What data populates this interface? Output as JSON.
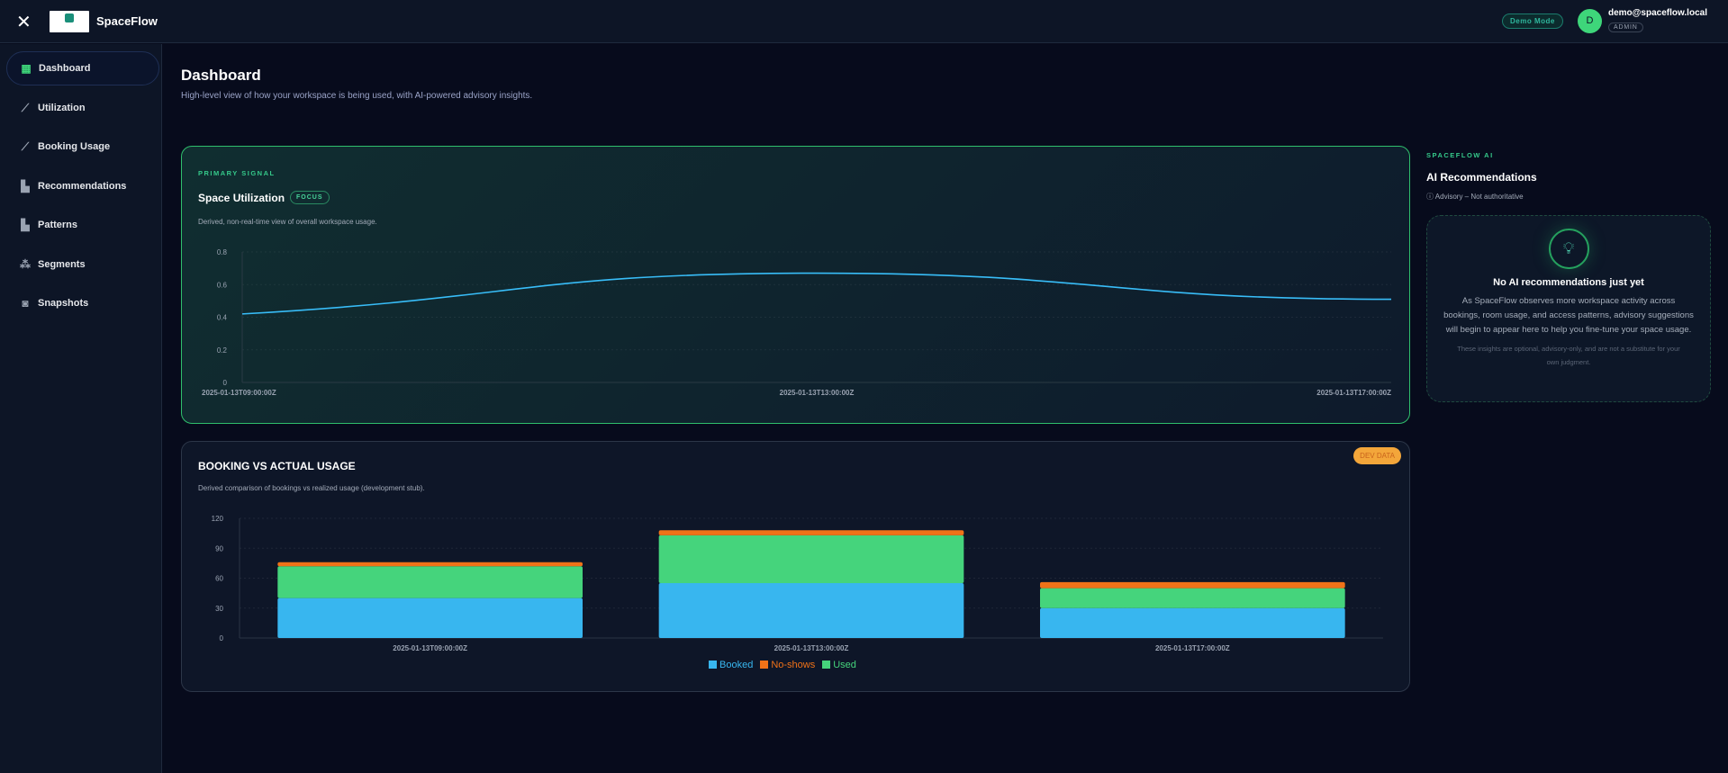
{
  "header": {
    "brand": "SpaceFlow",
    "demo_badge": "Demo Mode",
    "avatar_initial": "D",
    "email": "demo@spaceflow.local",
    "role": "ADMIN"
  },
  "sidebar": {
    "items": [
      {
        "label": "Dashboard",
        "icon": "dashboard-icon"
      },
      {
        "label": "Utilization",
        "icon": "sparkline-icon"
      },
      {
        "label": "Booking Usage",
        "icon": "trend-icon"
      },
      {
        "label": "Recommendations",
        "icon": "grid-icon"
      },
      {
        "label": "Patterns",
        "icon": "grid-icon"
      },
      {
        "label": "Segments",
        "icon": "group-icon"
      },
      {
        "label": "Snapshots",
        "icon": "camera-icon"
      }
    ]
  },
  "page": {
    "title": "Dashboard",
    "subtitle": "High-level view of how your workspace is being used, with AI-powered advisory insights."
  },
  "utilization": {
    "kicker": "PRIMARY SIGNAL",
    "title": "Space Utilization",
    "badge": "FOCUS",
    "description": "Derived, non-real-time view of overall workspace usage."
  },
  "booking": {
    "title": "BOOKING VS ACTUAL USAGE",
    "badge": "DEV DATA",
    "description": "Derived comparison of bookings vs realized usage (development stub)."
  },
  "ai": {
    "kicker": "SPACEFLOW AI",
    "title": "AI Recommendations",
    "note": "Advisory – Not authoritative",
    "empty_title": "No AI recommendations just yet",
    "empty_body": "As SpaceFlow observes more workspace activity across bookings, room usage, and access patterns, advisory suggestions will begin to appear here to help you fine-tune your space usage.",
    "empty_footnote": "These insights are optional, advisory-only, and are not a substitute for your own judgment."
  },
  "chart_data": [
    {
      "type": "line",
      "title": "Space Utilization",
      "x": [
        "2025-01-13T09:00:00Z",
        "2025-01-13T13:00:00Z",
        "2025-01-13T17:00:00Z"
      ],
      "values": [
        0.42,
        0.67,
        0.51
      ],
      "yticks": [
        "0",
        "0.2",
        "0.4",
        "0.6",
        "0.8"
      ],
      "ylim": [
        0,
        0.8
      ],
      "color": "#38bdf8"
    },
    {
      "type": "bar",
      "stacked": true,
      "title": "BOOKING VS ACTUAL USAGE",
      "categories": [
        "2025-01-13T09:00:00Z",
        "2025-01-13T13:00:00Z",
        "2025-01-13T17:00:00Z"
      ],
      "yticks": [
        "0",
        "30",
        "60",
        "90",
        "120"
      ],
      "ylim": [
        0,
        120
      ],
      "legend": "bottom",
      "series": [
        {
          "name": "Booked",
          "values": [
            40,
            55,
            30
          ],
          "color": "#38b6ef"
        },
        {
          "name": "Used",
          "values": [
            32,
            48,
            20
          ],
          "color": "#45d47c"
        },
        {
          "name": "No-shows",
          "values": [
            4,
            5,
            6
          ],
          "color": "#f07218"
        }
      ],
      "legend_order": [
        "Booked",
        "No-shows",
        "Used"
      ]
    }
  ]
}
